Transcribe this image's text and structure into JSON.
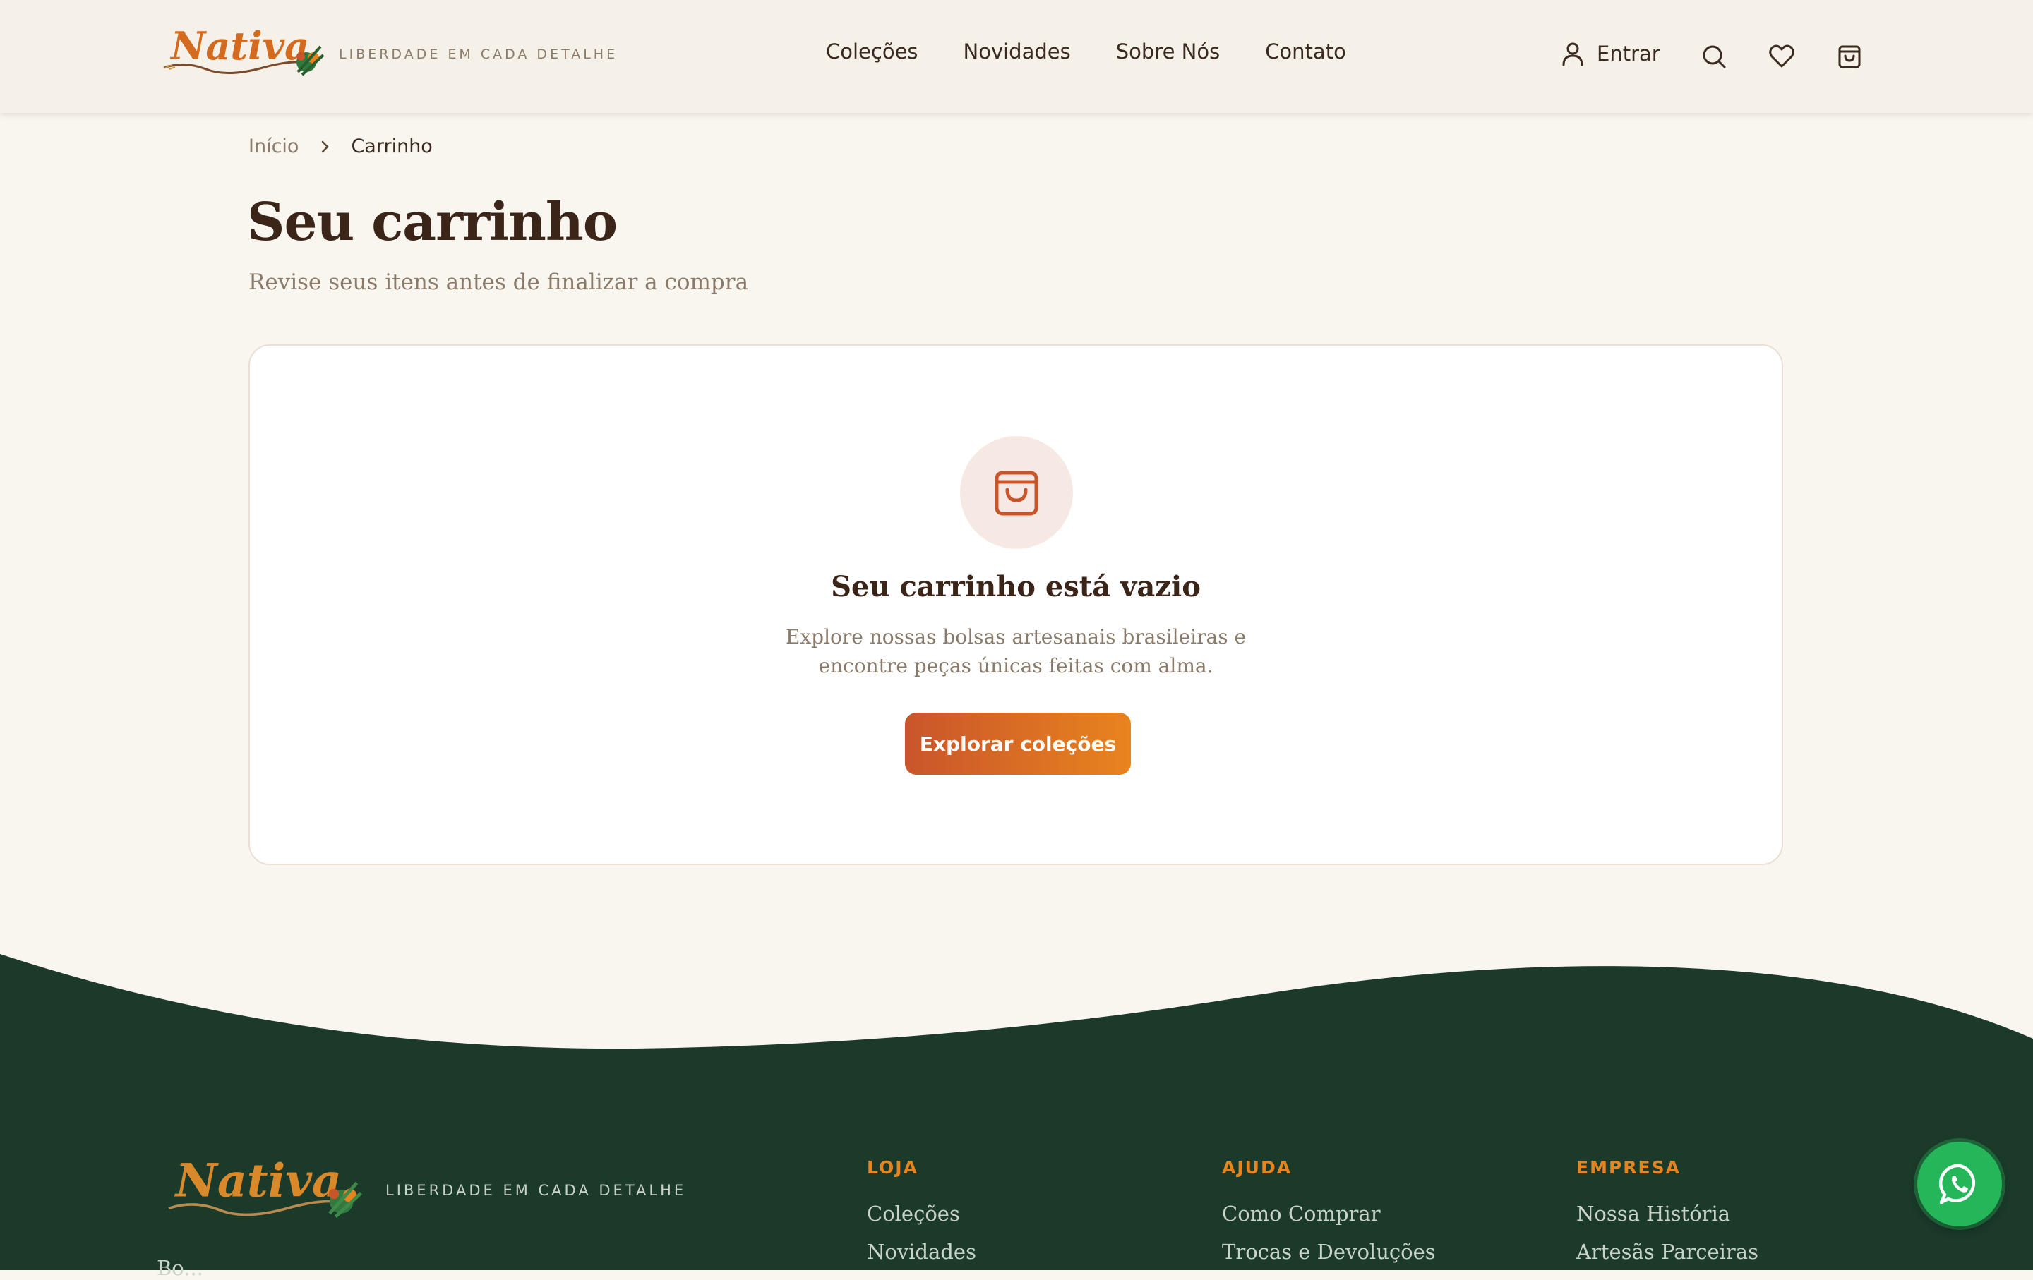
{
  "brand": {
    "logo_text": "Nativa",
    "tagline": "LIBERDADE EM CADA DETALHE"
  },
  "nav": {
    "items": [
      "Coleções",
      "Novidades",
      "Sobre Nós",
      "Contato"
    ]
  },
  "header_actions": {
    "login_label": "Entrar",
    "icons": [
      "user-icon",
      "search-icon",
      "heart-icon",
      "shopping-bag-icon"
    ]
  },
  "breadcrumb": {
    "home": "Início",
    "current": "Carrinho"
  },
  "page": {
    "title": "Seu carrinho",
    "subtitle": "Revise seus itens antes de finalizar a compra"
  },
  "empty_cart": {
    "icon": "shopping-bag-icon",
    "title": "Seu carrinho está vazio",
    "text_line1": "Explore nossas bolsas artesanais brasileiras e",
    "text_line2": "encontre peças únicas feitas com alma.",
    "button_label": "Explorar coleções"
  },
  "footer": {
    "description": "Bo...",
    "columns": [
      {
        "title": "LOJA",
        "links": [
          "Coleções",
          "Novidades"
        ]
      },
      {
        "title": "AJUDA",
        "links": [
          "Como Comprar",
          "Trocas e Devoluções"
        ]
      },
      {
        "title": "EMPRESA",
        "links": [
          "Nossa História",
          "Artesãs Parceiras"
        ]
      }
    ]
  },
  "colors": {
    "background": "#f9f5ef",
    "header": "#f5f1e9",
    "text_dark": "#3b2418",
    "text_muted": "#8a7a6a",
    "accent_orange": "#e8841e",
    "accent_rust": "#c9552b",
    "footer_green": "#1b3a2a",
    "whatsapp_green": "#25b65a"
  }
}
